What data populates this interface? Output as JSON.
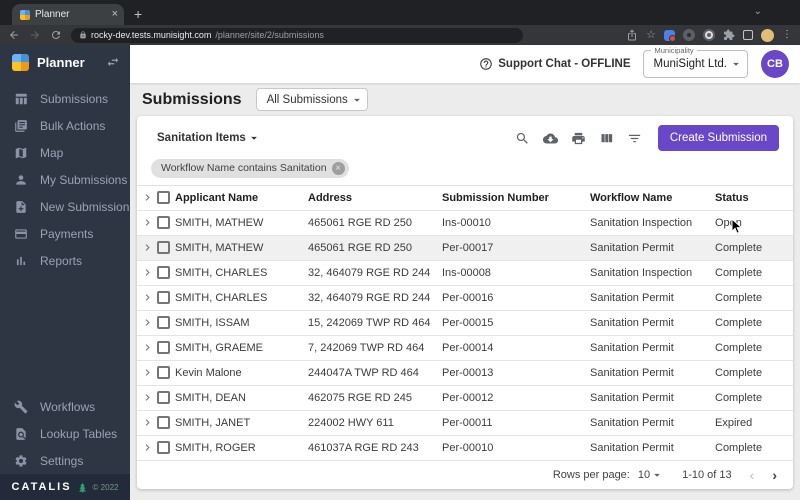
{
  "browser": {
    "tab_title": "Planner",
    "url_domain": "rocky-dev.tests.munisight.com",
    "url_path": "/planner/site/2/submissions"
  },
  "icons": {
    "close": "×",
    "new_tab": "+",
    "chevron_down": "⌄",
    "star": "☆",
    "kebab": "⋮",
    "page_prev": "‹",
    "page_next": "›",
    "chip_remove": "×"
  },
  "sidebar": {
    "app_name": "Planner",
    "nav_items": [
      "Submissions",
      "Bulk Actions",
      "Map",
      "My Submissions",
      "New Submission",
      "Payments",
      "Reports"
    ],
    "bottom_items": [
      "Workflows",
      "Lookup Tables",
      "Settings"
    ],
    "footer": {
      "brand": "CATALIS",
      "copyright": "© 2022"
    }
  },
  "header": {
    "support_chat": "Support Chat - OFFLINE",
    "municipality_label": "Municipality",
    "municipality_value": "MuniSight Ltd.",
    "avatar_initials": "CB"
  },
  "main": {
    "page_title": "Submissions",
    "view_selector": "All Submissions",
    "saved_filter": "Sanitation Items",
    "filter_chip": "Workflow Name contains Sanitation",
    "create_button": "Create Submission"
  },
  "table": {
    "columns": [
      "Applicant Name",
      "Address",
      "Submission Number",
      "Workflow Name",
      "Status"
    ],
    "hover_row_index": 1,
    "rows": [
      {
        "applicant": "SMITH, MATHEW",
        "address": "465061 RGE RD 250",
        "number": "Ins-00010",
        "workflow": "Sanitation Inspection",
        "status": "Open"
      },
      {
        "applicant": "SMITH, MATHEW",
        "address": "465061 RGE RD 250",
        "number": "Per-00017",
        "workflow": "Sanitation Permit",
        "status": "Complete"
      },
      {
        "applicant": "SMITH, CHARLES",
        "address": "32, 464079 RGE RD 244",
        "number": "Ins-00008",
        "workflow": "Sanitation Inspection",
        "status": "Complete"
      },
      {
        "applicant": "SMITH, CHARLES",
        "address": "32, 464079 RGE RD 244",
        "number": "Per-00016",
        "workflow": "Sanitation Permit",
        "status": "Complete"
      },
      {
        "applicant": "SMITH, ISSAM",
        "address": "15, 242069 TWP RD 464",
        "number": "Per-00015",
        "workflow": "Sanitation Permit",
        "status": "Complete"
      },
      {
        "applicant": "SMITH, GRAEME",
        "address": "7, 242069 TWP RD 464",
        "number": "Per-00014",
        "workflow": "Sanitation Permit",
        "status": "Complete"
      },
      {
        "applicant": "Kevin Malone",
        "address": "244047A TWP RD 464",
        "number": "Per-00013",
        "workflow": "Sanitation Permit",
        "status": "Complete"
      },
      {
        "applicant": "SMITH, DEAN",
        "address": "462075 RGE RD 245",
        "number": "Per-00012",
        "workflow": "Sanitation Permit",
        "status": "Complete"
      },
      {
        "applicant": "SMITH, JANET",
        "address": "224002 HWY 611",
        "number": "Per-00011",
        "workflow": "Sanitation Permit",
        "status": "Expired"
      },
      {
        "applicant": "SMITH, ROGER",
        "address": "461037A RGE RD 243",
        "number": "Per-00010",
        "workflow": "Sanitation Permit",
        "status": "Complete"
      }
    ]
  },
  "pagination": {
    "rows_per_page_label": "Rows per page:",
    "rows_per_page_value": "10",
    "range": "1-10 of 13"
  },
  "colors": {
    "accent_purple": "#6a47c8",
    "sidebar_bg": "#2e3644",
    "sidebar_footer_bg": "#232b3a",
    "content_bg": "#ececec",
    "browser_strip_bg": "#202124",
    "browser_toolbar_bg": "#35363a",
    "catalis_green": "#2ea06a"
  }
}
